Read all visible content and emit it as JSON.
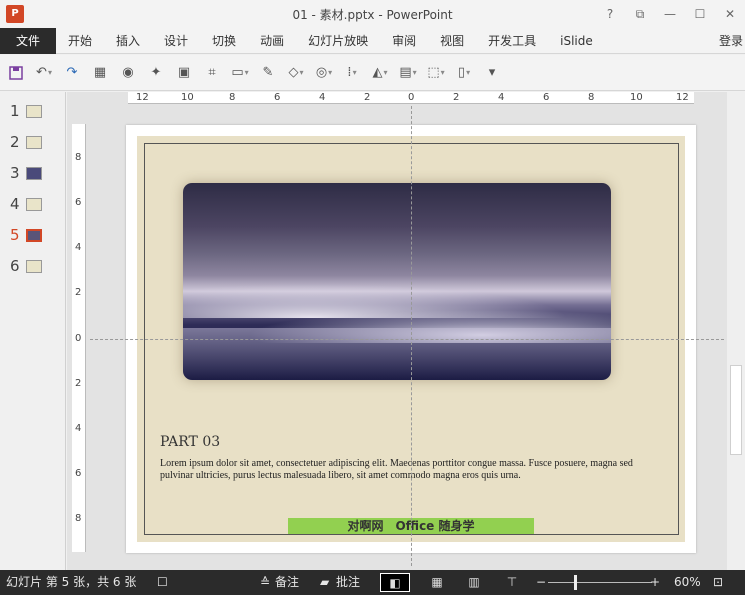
{
  "window": {
    "app_logo": "P",
    "title": "01 - 素材.pptx - PowerPoint",
    "controls": [
      "?",
      "⧉",
      "—",
      "☐",
      "✕"
    ]
  },
  "ribbon": {
    "file_tab": "文件",
    "tabs": [
      "开始",
      "插入",
      "设计",
      "切换",
      "动画",
      "幻灯片放映",
      "审阅",
      "视图",
      "开发工具",
      "iSlide"
    ],
    "login": "登录"
  },
  "toolbar_icons": [
    "save-icon",
    "undo-icon",
    "redo-icon",
    "table-icon",
    "camera-icon",
    "star-icon",
    "format-painter-icon",
    "crop-icon",
    "textbox-icon",
    "paint-brush-icon",
    "shape-icon",
    "merge-shapes-icon",
    "align-icon",
    "rotate-icon",
    "arrange-icon",
    "group-icon",
    "slideshow-icon",
    "more-icon"
  ],
  "thumbnails": [
    "1",
    "2",
    "3",
    "4",
    "5",
    "6"
  ],
  "active_slide": 5,
  "rulers": {
    "horizontal": [
      "12",
      "10",
      "8",
      "6",
      "4",
      "2",
      "0",
      "2",
      "4",
      "6",
      "8",
      "10",
      "12"
    ],
    "vertical": [
      "8",
      "6",
      "4",
      "2",
      "0",
      "2",
      "4",
      "6",
      "8"
    ]
  },
  "slide": {
    "heading": "PART 03",
    "body": "Lorem ipsum dolor sit amet, consectetuer adipiscing elit. Maecenas porttitor congue massa. Fusce posuere, magna sed pulvinar ultricies, purus lectus malesuada libero, sit amet commodo magna eros quis urna.",
    "banner": "对啊网　Office 随身学"
  },
  "status": {
    "slide_info": "幻灯片 第 5 张，共 6 张",
    "notes": "备注",
    "comments": "批注",
    "zoom_minus": "−",
    "zoom_plus": "+",
    "zoom": "60%"
  },
  "colors": {
    "accent": "#d24726",
    "slide_bg": "#e8e0c6",
    "banner": "#92d050",
    "statusbar": "#2b2b2b"
  }
}
